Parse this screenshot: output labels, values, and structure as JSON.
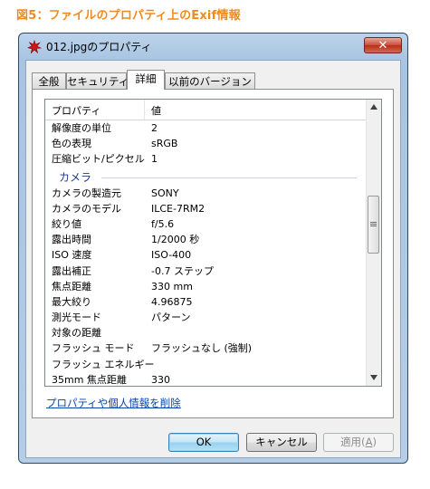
{
  "figure_caption": "図5：ファイルのプロパティ上のExif情報",
  "window": {
    "title": "012.jpgのプロパティ",
    "close_label": "✕"
  },
  "tabs": [
    {
      "label": "全般",
      "active": false
    },
    {
      "label": "セキュリティ",
      "active": false
    },
    {
      "label": "詳細",
      "active": true
    },
    {
      "label": "以前のバージョン",
      "active": false
    }
  ],
  "details": {
    "col_property": "プロパティ",
    "col_value": "値",
    "rows_top": [
      {
        "name": "解像度の単位",
        "value": "2"
      },
      {
        "name": "色の表現",
        "value": "sRGB"
      },
      {
        "name": "圧縮ビット/ピクセル",
        "value": "1"
      }
    ],
    "group_camera": "カメラ",
    "rows_camera": [
      {
        "name": "カメラの製造元",
        "value": "SONY"
      },
      {
        "name": "カメラのモデル",
        "value": "ILCE-7RM2"
      },
      {
        "name": "絞り値",
        "value": "f/5.6"
      },
      {
        "name": "露出時間",
        "value": "1/2000 秒"
      },
      {
        "name": "ISO 速度",
        "value": "ISO-400"
      },
      {
        "name": "露出補正",
        "value": "-0.7 ステップ"
      },
      {
        "name": "焦点距離",
        "value": "330 mm"
      },
      {
        "name": "最大絞り",
        "value": "4.96875"
      },
      {
        "name": "測光モード",
        "value": "パターン"
      },
      {
        "name": "対象の距離",
        "value": ""
      },
      {
        "name": "フラッシュ モード",
        "value": "フラッシュなし (強制)"
      },
      {
        "name": "フラッシュ エネルギー",
        "value": ""
      },
      {
        "name": "35mm 焦点距離",
        "value": "330"
      }
    ]
  },
  "remove_link": "プロパティや個人情報を削除",
  "buttons": {
    "ok": "OK",
    "cancel": "キャンセル",
    "apply": "適用(",
    "apply_key": "A",
    "apply_end": ")"
  },
  "icons": {
    "window": "red-splat-icon",
    "scroll_up": "triangle-up-icon",
    "scroll_down": "triangle-down-icon"
  }
}
